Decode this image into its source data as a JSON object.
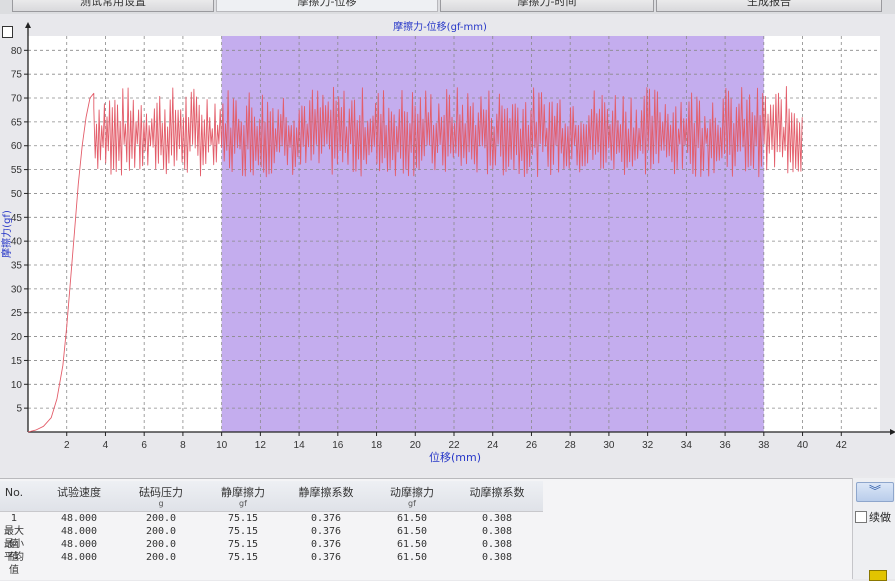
{
  "tabs": [
    {
      "label": "测试常用设置",
      "active": false
    },
    {
      "label": "摩擦力-位移",
      "active": true
    },
    {
      "label": "摩擦力-时间",
      "active": false
    },
    {
      "label": "生成报告",
      "active": false
    }
  ],
  "chart_data": {
    "type": "line",
    "title": "摩擦力-位移(gf-mm)",
    "xlabel": "位移(mm)",
    "ylabel": "摩擦力(gf)",
    "xlim": [
      0,
      44
    ],
    "ylim": [
      0,
      83
    ],
    "xticks": [
      2,
      4,
      6,
      8,
      10,
      12,
      14,
      16,
      18,
      20,
      22,
      24,
      26,
      28,
      30,
      32,
      34,
      36,
      38,
      40,
      42
    ],
    "yticks": [
      5,
      10,
      15,
      20,
      25,
      30,
      35,
      40,
      45,
      50,
      55,
      60,
      65,
      70,
      75,
      80
    ],
    "highlight_range": [
      10.0,
      38.0
    ],
    "series_color": "#e35d6a",
    "highlight_color": "#b79bea",
    "grid": true,
    "series": [
      {
        "rise": [
          [
            0.0,
            0.0
          ],
          [
            0.4,
            0.4
          ],
          [
            0.8,
            1.2
          ],
          [
            1.2,
            3.0
          ],
          [
            1.5,
            7.0
          ],
          [
            1.8,
            14.0
          ],
          [
            2.0,
            22.0
          ],
          [
            2.2,
            32.0
          ],
          [
            2.4,
            42.0
          ],
          [
            2.6,
            52.0
          ],
          [
            2.8,
            60.0
          ],
          [
            3.0,
            66.0
          ],
          [
            3.2,
            70.0
          ],
          [
            3.4,
            71.0
          ]
        ],
        "oscillation": {
          "x_start": 3.4,
          "x_end": 40.0,
          "upper_mean": 68.0,
          "lower_mean": 57.0,
          "upper_max": 74.5,
          "lower_min": 51.0
        }
      }
    ]
  },
  "table": {
    "headers": [
      {
        "label": "No.",
        "unit": ""
      },
      {
        "label": "试验速度",
        "unit": ""
      },
      {
        "label": "砝码压力",
        "unit": "g"
      },
      {
        "label": "静摩擦力",
        "unit": "gf"
      },
      {
        "label": "静摩擦系数",
        "unit": ""
      },
      {
        "label": "动摩擦力",
        "unit": "gf"
      },
      {
        "label": "动摩擦系数",
        "unit": ""
      }
    ],
    "rows": [
      [
        "1",
        "48.000",
        "200.0",
        "75.15",
        "0.376",
        "61.50",
        "0.308"
      ],
      [
        "最大值",
        "48.000",
        "200.0",
        "75.15",
        "0.376",
        "61.50",
        "0.308"
      ],
      [
        "最小值",
        "48.000",
        "200.0",
        "75.15",
        "0.376",
        "61.50",
        "0.308"
      ],
      [
        "平均值",
        "48.000",
        "200.0",
        "75.15",
        "0.376",
        "61.50",
        "0.308"
      ]
    ]
  },
  "side": {
    "expand_icon": "double-chevron-down-icon",
    "continue_label": "续做"
  }
}
